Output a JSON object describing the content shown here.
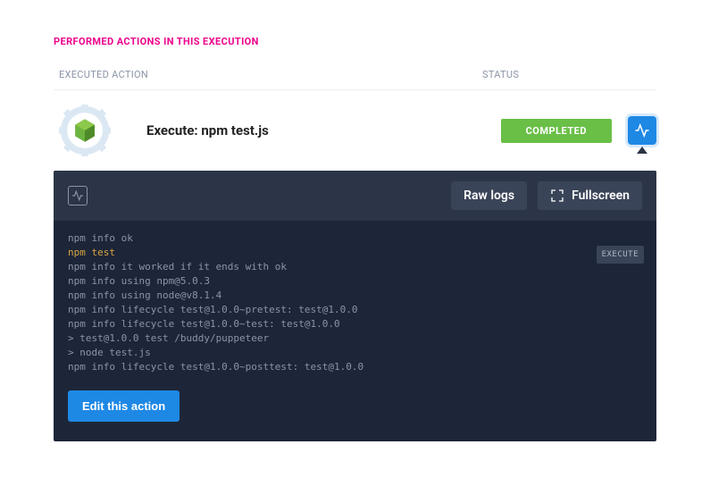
{
  "section_title": "PERFORMED ACTIONS IN THIS EXECUTION",
  "columns": {
    "action": "EXECUTED ACTION",
    "status": "STATUS"
  },
  "row": {
    "title": "Execute: npm test.js",
    "status": "COMPLETED"
  },
  "console": {
    "raw_logs_label": "Raw logs",
    "fullscreen_label": "Fullscreen",
    "execute_tag": "EXECUTE",
    "edit_label": "Edit this action",
    "logs": [
      {
        "text": "npm info ok",
        "cls": ""
      },
      {
        "text": "npm test",
        "cls": "cmd"
      },
      {
        "text": "npm info it worked if it ends with ok",
        "cls": ""
      },
      {
        "text": "npm info using npm@5.0.3",
        "cls": ""
      },
      {
        "text": "npm info using node@v8.1.4",
        "cls": ""
      },
      {
        "text": "npm info lifecycle test@1.0.0~pretest: test@1.0.0",
        "cls": ""
      },
      {
        "text": "npm info lifecycle test@1.0.0~test: test@1.0.0",
        "cls": ""
      },
      {
        "text": "> test@1.0.0 test /buddy/puppeteer",
        "cls": ""
      },
      {
        "text": "> node test.js",
        "cls": ""
      },
      {
        "text": "npm info lifecycle test@1.0.0~posttest: test@1.0.0",
        "cls": ""
      }
    ]
  },
  "icons": {
    "activity": "activity-icon",
    "fullscreen": "fullscreen-icon",
    "gear_node": "node-gear-icon"
  }
}
